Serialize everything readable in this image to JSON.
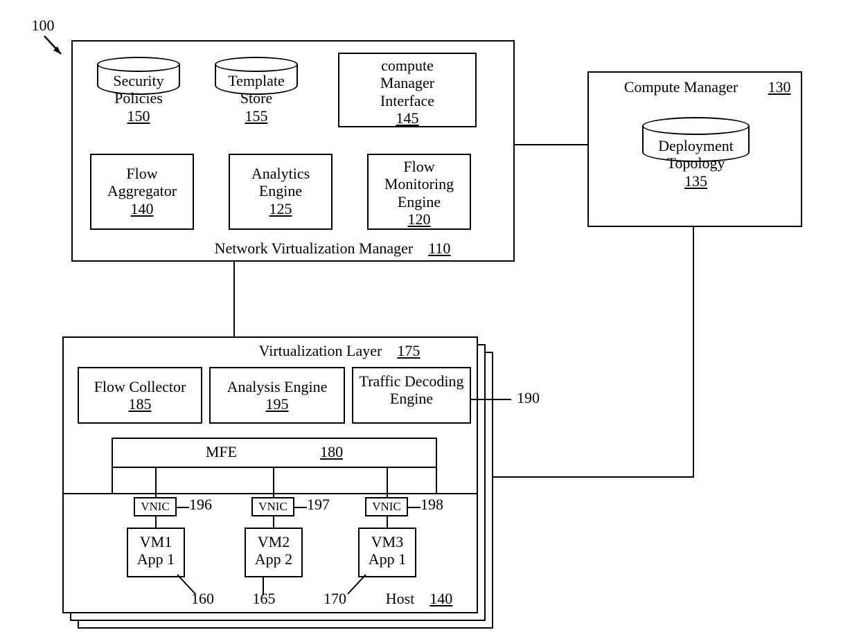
{
  "figure_ref": "100",
  "nvm": {
    "title": "Network Virtualization Manager",
    "ref": "110",
    "sec_policies": {
      "label": "Security\nPolicies",
      "ref": "150"
    },
    "template_store": {
      "label": "Template\nStore",
      "ref": "155"
    },
    "cmi": {
      "label": "compute\nManager\nInterface",
      "ref": "145"
    },
    "flow_agg": {
      "label": "Flow\nAggregator",
      "ref": "140"
    },
    "analytics": {
      "label": "Analytics\nEngine",
      "ref": "125"
    },
    "flow_mon": {
      "label": "Flow\nMonitoring\nEngine",
      "ref": "120"
    }
  },
  "compute_mgr": {
    "title": "Compute Manager",
    "ref": "130",
    "topology": {
      "label": "Deployment\nTopology",
      "ref": "135"
    }
  },
  "virt_layer": {
    "title": "Virtualization Layer",
    "ref": "175",
    "flow_collector": {
      "label": "Flow Collector",
      "ref": "185"
    },
    "analysis_engine": {
      "label": "Analysis Engine",
      "ref": "195"
    },
    "traffic_decode": {
      "label": "Traffic Decoding\nEngine",
      "ref_label": "190"
    },
    "mfe": {
      "label": "MFE",
      "ref": "180"
    }
  },
  "host": {
    "label": "Host",
    "ref": "140",
    "vnic1": {
      "label": "VNIC",
      "ref": "196"
    },
    "vnic2": {
      "label": "VNIC",
      "ref": "197"
    },
    "vnic3": {
      "label": "VNIC",
      "ref": "198"
    },
    "vm1": {
      "line1": "VM1",
      "line2": "App 1",
      "ref": "160"
    },
    "vm2": {
      "line1": "VM2",
      "line2": "App 2",
      "ref": "165"
    },
    "vm3": {
      "line1": "VM3",
      "line2": "App 1",
      "ref": "170"
    }
  }
}
